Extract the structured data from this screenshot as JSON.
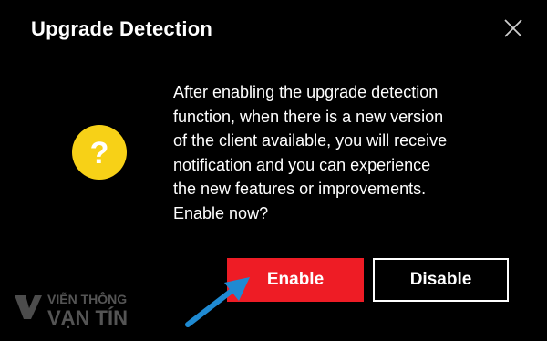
{
  "dialog": {
    "title": "Upgrade Detection",
    "message": "After enabling the upgrade detection\nfunction, when there is a new version\nof the client available, you will receive\nnotification and you can experience\nthe new features or improvements.\nEnable now?",
    "icon": "question-icon",
    "buttons": {
      "enable_label": "Enable",
      "disable_label": "Disable"
    },
    "close_icon": "close-icon"
  },
  "watermark": {
    "line1": "VIỄN THÔNG",
    "line2": "VẠN TÍN"
  },
  "colors": {
    "background": "#000000",
    "enable_button": "#ee1c25",
    "question_icon": "#f7d117",
    "arrow": "#1f8ad2"
  }
}
